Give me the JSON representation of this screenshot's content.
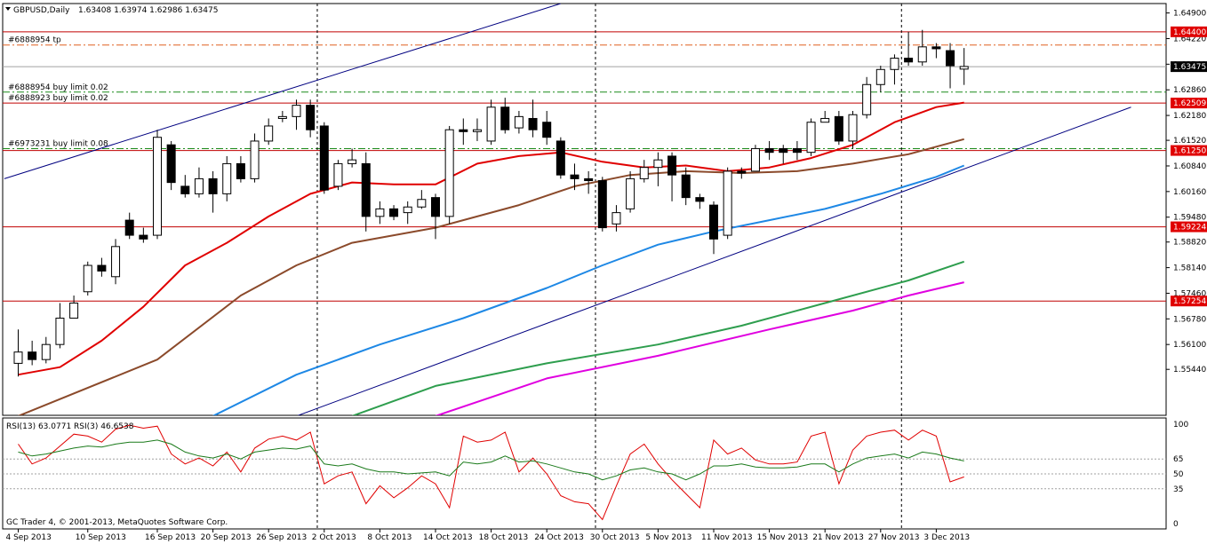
{
  "header": {
    "symbol_label": "GBPUSD,Daily",
    "ohlc_label": "1.63408 1.63974 1.62986 1.63475"
  },
  "footer": {
    "copyright": "GC Trader 4, © 2001-2013, MetaQuotes Software Corp."
  },
  "colors": {
    "candle_border": "#000000",
    "bull_fill": "#ffffff",
    "bear_fill": "#000000",
    "ma_red": "#e00000",
    "ma_brown": "#8b4a2b",
    "ma_blue": "#1e88e5",
    "ma_green": "#2e9e4e",
    "ma_magenta": "#e000e0",
    "trendline": "#000080",
    "hline_red": "#c00000",
    "tp_line": "#e06020",
    "buy_limit_line": "#1a8a1a",
    "rsi13": "#1a7a1a",
    "rsi3": "#e00000",
    "badge_red": "#e00000",
    "badge_black": "#000000"
  },
  "chart_data": {
    "type": "candlestick",
    "symbol": "GBPUSD",
    "timeframe": "Daily",
    "price_axis": {
      "range": [
        1.5422,
        1.6515
      ],
      "ticks": [
        "1.64900",
        "1.64220",
        "1.63540",
        "1.62860",
        "1.62180",
        "1.61520",
        "1.60840",
        "1.60160",
        "1.59480",
        "1.58820",
        "1.58140",
        "1.57460",
        "1.56780",
        "1.56100",
        "1.55440"
      ]
    },
    "date_labels": [
      {
        "index": 0,
        "label": "4 Sep 2013"
      },
      {
        "index": 5,
        "label": "10 Sep 2013"
      },
      {
        "index": 10,
        "label": "16 Sep 2013"
      },
      {
        "index": 14,
        "label": "20 Sep 2013"
      },
      {
        "index": 18,
        "label": "26 Sep 2013"
      },
      {
        "index": 22,
        "label": "2 Oct 2013"
      },
      {
        "index": 26,
        "label": "8 Oct 2013"
      },
      {
        "index": 30,
        "label": "14 Oct 2013"
      },
      {
        "index": 34,
        "label": "18 Oct 2013"
      },
      {
        "index": 38,
        "label": "24 Oct 2013"
      },
      {
        "index": 42,
        "label": "30 Oct 2013"
      },
      {
        "index": 46,
        "label": "5 Nov 2013"
      },
      {
        "index": 50,
        "label": "11 Nov 2013"
      },
      {
        "index": 54,
        "label": "15 Nov 2013"
      },
      {
        "index": 58,
        "label": "21 Nov 2013"
      },
      {
        "index": 62,
        "label": "27 Nov 2013"
      },
      {
        "index": 66,
        "label": "3 Dec 2013"
      }
    ],
    "candles": [
      {
        "o": 1.556,
        "h": 1.565,
        "l": 1.5525,
        "c": 1.559
      },
      {
        "o": 1.559,
        "h": 1.562,
        "l": 1.5555,
        "c": 1.557
      },
      {
        "o": 1.557,
        "h": 1.563,
        "l": 1.556,
        "c": 1.561
      },
      {
        "o": 1.561,
        "h": 1.572,
        "l": 1.56,
        "c": 1.568
      },
      {
        "o": 1.568,
        "h": 1.574,
        "l": 1.568,
        "c": 1.572
      },
      {
        "o": 1.575,
        "h": 1.583,
        "l": 1.574,
        "c": 1.582
      },
      {
        "o": 1.582,
        "h": 1.584,
        "l": 1.579,
        "c": 1.5805
      },
      {
        "o": 1.579,
        "h": 1.589,
        "l": 1.577,
        "c": 1.587
      },
      {
        "o": 1.594,
        "h": 1.596,
        "l": 1.589,
        "c": 1.59
      },
      {
        "o": 1.59,
        "h": 1.592,
        "l": 1.588,
        "c": 1.589
      },
      {
        "o": 1.59,
        "h": 1.618,
        "l": 1.589,
        "c": 1.616
      },
      {
        "o": 1.614,
        "h": 1.615,
        "l": 1.602,
        "c": 1.604
      },
      {
        "o": 1.603,
        "h": 1.606,
        "l": 1.6,
        "c": 1.601
      },
      {
        "o": 1.601,
        "h": 1.608,
        "l": 1.6,
        "c": 1.605
      },
      {
        "o": 1.605,
        "h": 1.607,
        "l": 1.596,
        "c": 1.601
      },
      {
        "o": 1.601,
        "h": 1.611,
        "l": 1.599,
        "c": 1.609
      },
      {
        "o": 1.609,
        "h": 1.611,
        "l": 1.604,
        "c": 1.605
      },
      {
        "o": 1.605,
        "h": 1.617,
        "l": 1.604,
        "c": 1.615
      },
      {
        "o": 1.615,
        "h": 1.621,
        "l": 1.614,
        "c": 1.619
      },
      {
        "o": 1.621,
        "h": 1.623,
        "l": 1.62,
        "c": 1.6215
      },
      {
        "o": 1.6215,
        "h": 1.626,
        "l": 1.618,
        "c": 1.6245
      },
      {
        "o": 1.6245,
        "h": 1.626,
        "l": 1.616,
        "c": 1.618
      },
      {
        "o": 1.619,
        "h": 1.62,
        "l": 1.601,
        "c": 1.602
      },
      {
        "o": 1.603,
        "h": 1.61,
        "l": 1.602,
        "c": 1.609
      },
      {
        "o": 1.609,
        "h": 1.613,
        "l": 1.608,
        "c": 1.61
      },
      {
        "o": 1.609,
        "h": 1.612,
        "l": 1.591,
        "c": 1.595
      },
      {
        "o": 1.595,
        "h": 1.599,
        "l": 1.593,
        "c": 1.597
      },
      {
        "o": 1.597,
        "h": 1.598,
        "l": 1.594,
        "c": 1.595
      },
      {
        "o": 1.596,
        "h": 1.599,
        "l": 1.593,
        "c": 1.5975
      },
      {
        "o": 1.5975,
        "h": 1.602,
        "l": 1.597,
        "c": 1.5995
      },
      {
        "o": 1.6,
        "h": 1.601,
        "l": 1.589,
        "c": 1.595
      },
      {
        "o": 1.595,
        "h": 1.619,
        "l": 1.593,
        "c": 1.618
      },
      {
        "o": 1.618,
        "h": 1.621,
        "l": 1.614,
        "c": 1.6175
      },
      {
        "o": 1.6175,
        "h": 1.621,
        "l": 1.615,
        "c": 1.618
      },
      {
        "o": 1.615,
        "h": 1.626,
        "l": 1.614,
        "c": 1.624
      },
      {
        "o": 1.624,
        "h": 1.6265,
        "l": 1.617,
        "c": 1.618
      },
      {
        "o": 1.6185,
        "h": 1.623,
        "l": 1.617,
        "c": 1.6215
      },
      {
        "o": 1.621,
        "h": 1.626,
        "l": 1.616,
        "c": 1.618
      },
      {
        "o": 1.62,
        "h": 1.623,
        "l": 1.614,
        "c": 1.616
      },
      {
        "o": 1.615,
        "h": 1.616,
        "l": 1.605,
        "c": 1.606
      },
      {
        "o": 1.606,
        "h": 1.609,
        "l": 1.602,
        "c": 1.605
      },
      {
        "o": 1.605,
        "h": 1.607,
        "l": 1.601,
        "c": 1.6045
      },
      {
        "o": 1.6045,
        "h": 1.6055,
        "l": 1.591,
        "c": 1.592
      },
      {
        "o": 1.593,
        "h": 1.598,
        "l": 1.591,
        "c": 1.596
      },
      {
        "o": 1.597,
        "h": 1.607,
        "l": 1.596,
        "c": 1.605
      },
      {
        "o": 1.605,
        "h": 1.61,
        "l": 1.604,
        "c": 1.608
      },
      {
        "o": 1.608,
        "h": 1.612,
        "l": 1.603,
        "c": 1.61
      },
      {
        "o": 1.611,
        "h": 1.612,
        "l": 1.599,
        "c": 1.606
      },
      {
        "o": 1.606,
        "h": 1.608,
        "l": 1.598,
        "c": 1.6
      },
      {
        "o": 1.6,
        "h": 1.601,
        "l": 1.597,
        "c": 1.599
      },
      {
        "o": 1.598,
        "h": 1.599,
        "l": 1.585,
        "c": 1.589
      },
      {
        "o": 1.59,
        "h": 1.608,
        "l": 1.589,
        "c": 1.607
      },
      {
        "o": 1.607,
        "h": 1.608,
        "l": 1.605,
        "c": 1.6065
      },
      {
        "o": 1.607,
        "h": 1.614,
        "l": 1.607,
        "c": 1.613
      },
      {
        "o": 1.613,
        "h": 1.615,
        "l": 1.61,
        "c": 1.612
      },
      {
        "o": 1.613,
        "h": 1.614,
        "l": 1.609,
        "c": 1.612
      },
      {
        "o": 1.613,
        "h": 1.615,
        "l": 1.61,
        "c": 1.612
      },
      {
        "o": 1.612,
        "h": 1.621,
        "l": 1.611,
        "c": 1.62
      },
      {
        "o": 1.62,
        "h": 1.623,
        "l": 1.62,
        "c": 1.621
      },
      {
        "o": 1.6215,
        "h": 1.623,
        "l": 1.614,
        "c": 1.615
      },
      {
        "o": 1.615,
        "h": 1.623,
        "l": 1.613,
        "c": 1.622
      },
      {
        "o": 1.622,
        "h": 1.632,
        "l": 1.621,
        "c": 1.63
      },
      {
        "o": 1.63,
        "h": 1.635,
        "l": 1.628,
        "c": 1.634
      },
      {
        "o": 1.634,
        "h": 1.638,
        "l": 1.63,
        "c": 1.637
      },
      {
        "o": 1.637,
        "h": 1.644,
        "l": 1.635,
        "c": 1.636
      },
      {
        "o": 1.636,
        "h": 1.6445,
        "l": 1.635,
        "c": 1.64
      },
      {
        "o": 1.64,
        "h": 1.641,
        "l": 1.637,
        "c": 1.6395
      },
      {
        "o": 1.639,
        "h": 1.641,
        "l": 1.629,
        "c": 1.635
      },
      {
        "o": 1.6341,
        "h": 1.6397,
        "l": 1.6299,
        "c": 1.6348
      }
    ],
    "moving_averages": [
      {
        "color_key": "ma_red",
        "points": [
          [
            0,
            1.553
          ],
          [
            3,
            1.555
          ],
          [
            6,
            1.562
          ],
          [
            9,
            1.571
          ],
          [
            12,
            1.582
          ],
          [
            15,
            1.588
          ],
          [
            18,
            1.595
          ],
          [
            21,
            1.601
          ],
          [
            24,
            1.604
          ],
          [
            27,
            1.6035
          ],
          [
            30,
            1.6035
          ],
          [
            33,
            1.609
          ],
          [
            36,
            1.611
          ],
          [
            39,
            1.612
          ],
          [
            42,
            1.6095
          ],
          [
            45,
            1.608
          ],
          [
            48,
            1.6085
          ],
          [
            51,
            1.607
          ],
          [
            54,
            1.608
          ],
          [
            57,
            1.6105
          ],
          [
            60,
            1.614
          ],
          [
            63,
            1.62
          ],
          [
            66,
            1.624
          ],
          [
            68,
            1.6252
          ]
        ]
      },
      {
        "color_key": "ma_brown",
        "points": [
          [
            0,
            1.542
          ],
          [
            10,
            1.557
          ],
          [
            16,
            1.574
          ],
          [
            20,
            1.582
          ],
          [
            24,
            1.588
          ],
          [
            30,
            1.592
          ],
          [
            36,
            1.598
          ],
          [
            40,
            1.603
          ],
          [
            44,
            1.606
          ],
          [
            48,
            1.607
          ],
          [
            52,
            1.6065
          ],
          [
            56,
            1.607
          ],
          [
            60,
            1.609
          ],
          [
            64,
            1.6115
          ],
          [
            68,
            1.6155
          ]
        ]
      },
      {
        "color_key": "ma_blue",
        "points": [
          [
            14,
            1.542
          ],
          [
            20,
            1.553
          ],
          [
            26,
            1.561
          ],
          [
            32,
            1.568
          ],
          [
            38,
            1.576
          ],
          [
            42,
            1.582
          ],
          [
            46,
            1.5875
          ],
          [
            50,
            1.591
          ],
          [
            54,
            1.594
          ],
          [
            58,
            1.597
          ],
          [
            62,
            1.601
          ],
          [
            66,
            1.6055
          ],
          [
            68,
            1.6085
          ]
        ]
      },
      {
        "color_key": "ma_green",
        "points": [
          [
            24,
            1.542
          ],
          [
            30,
            1.55
          ],
          [
            38,
            1.556
          ],
          [
            46,
            1.561
          ],
          [
            52,
            1.566
          ],
          [
            58,
            1.572
          ],
          [
            64,
            1.578
          ],
          [
            68,
            1.583
          ]
        ]
      },
      {
        "color_key": "ma_magenta",
        "points": [
          [
            30,
            1.542
          ],
          [
            38,
            1.552
          ],
          [
            46,
            1.558
          ],
          [
            54,
            1.565
          ],
          [
            60,
            1.57
          ],
          [
            64,
            1.574
          ],
          [
            68,
            1.5775
          ]
        ]
      }
    ],
    "trendlines": [
      {
        "p1": [
          -1,
          1.605
        ],
        "p2": [
          39,
          1.6515
        ]
      },
      {
        "p1": [
          20,
          1.542
        ],
        "p2": [
          80,
          1.624
        ]
      }
    ],
    "horizontal_levels": [
      {
        "price": 1.644,
        "label": "1.64400",
        "style": "red-solid",
        "badge": "red"
      },
      {
        "price": 1.6405,
        "label": "",
        "style": "tp-dashdot",
        "badge": ""
      },
      {
        "price": 1.63475,
        "label": "1.63475",
        "style": "gray-solid",
        "badge": "black"
      },
      {
        "price": 1.628,
        "label": "",
        "style": "buy-dashdot",
        "badge": ""
      },
      {
        "price": 1.62509,
        "label": "1.62509",
        "style": "red-solid",
        "badge": "red"
      },
      {
        "price": 1.613,
        "label": "",
        "style": "buy-dashdot",
        "badge": ""
      },
      {
        "price": 1.6125,
        "label": "1.61250",
        "style": "red-solid",
        "badge": "red"
      },
      {
        "price": 1.59224,
        "label": "1.59224",
        "style": "red-solid",
        "badge": "red"
      },
      {
        "price": 1.57254,
        "label": "1.57254",
        "style": "red-solid",
        "badge": "red"
      }
    ],
    "order_labels": [
      {
        "price": 1.6405,
        "text": "#6888954 tp"
      },
      {
        "price": 1.628,
        "text": "#6888954 buy limit 0.02"
      },
      {
        "price": 1.62509,
        "text": "#6888923 buy limit 0.02"
      },
      {
        "price": 1.613,
        "text": "#6973231 buy limit 0.08"
      }
    ],
    "vertical_markers": [
      21.5,
      41.5,
      63.5
    ],
    "rsi": {
      "label": "RSI(13) 63.0771  RSI(3) 46.6538",
      "range": [
        0,
        100
      ],
      "ticks": [
        "100",
        "65",
        "50",
        "35",
        "0"
      ],
      "levels": [
        65,
        50,
        35
      ],
      "rsi13": [
        72,
        68,
        70,
        73,
        76,
        78,
        77,
        80,
        82,
        82,
        84,
        80,
        72,
        68,
        66,
        70,
        65,
        72,
        74,
        76,
        75,
        78,
        60,
        58,
        60,
        55,
        52,
        52,
        50,
        51,
        52,
        48,
        62,
        60,
        62,
        68,
        62,
        63,
        60,
        56,
        52,
        50,
        44,
        48,
        54,
        56,
        52,
        50,
        44,
        50,
        58,
        58,
        60,
        57,
        56,
        56,
        57,
        60,
        60,
        52,
        60,
        66,
        68,
        70,
        66,
        72,
        70,
        66,
        63
      ],
      "rsi3": [
        80,
        60,
        66,
        78,
        90,
        88,
        82,
        95,
        99,
        96,
        98,
        70,
        60,
        66,
        58,
        72,
        52,
        76,
        85,
        88,
        84,
        92,
        40,
        48,
        52,
        20,
        38,
        26,
        36,
        48,
        40,
        16,
        88,
        82,
        84,
        92,
        52,
        66,
        50,
        28,
        22,
        20,
        4,
        38,
        70,
        80,
        60,
        44,
        30,
        16,
        84,
        70,
        76,
        64,
        60,
        60,
        62,
        88,
        92,
        40,
        74,
        88,
        92,
        94,
        84,
        94,
        88,
        42,
        47
      ]
    }
  }
}
